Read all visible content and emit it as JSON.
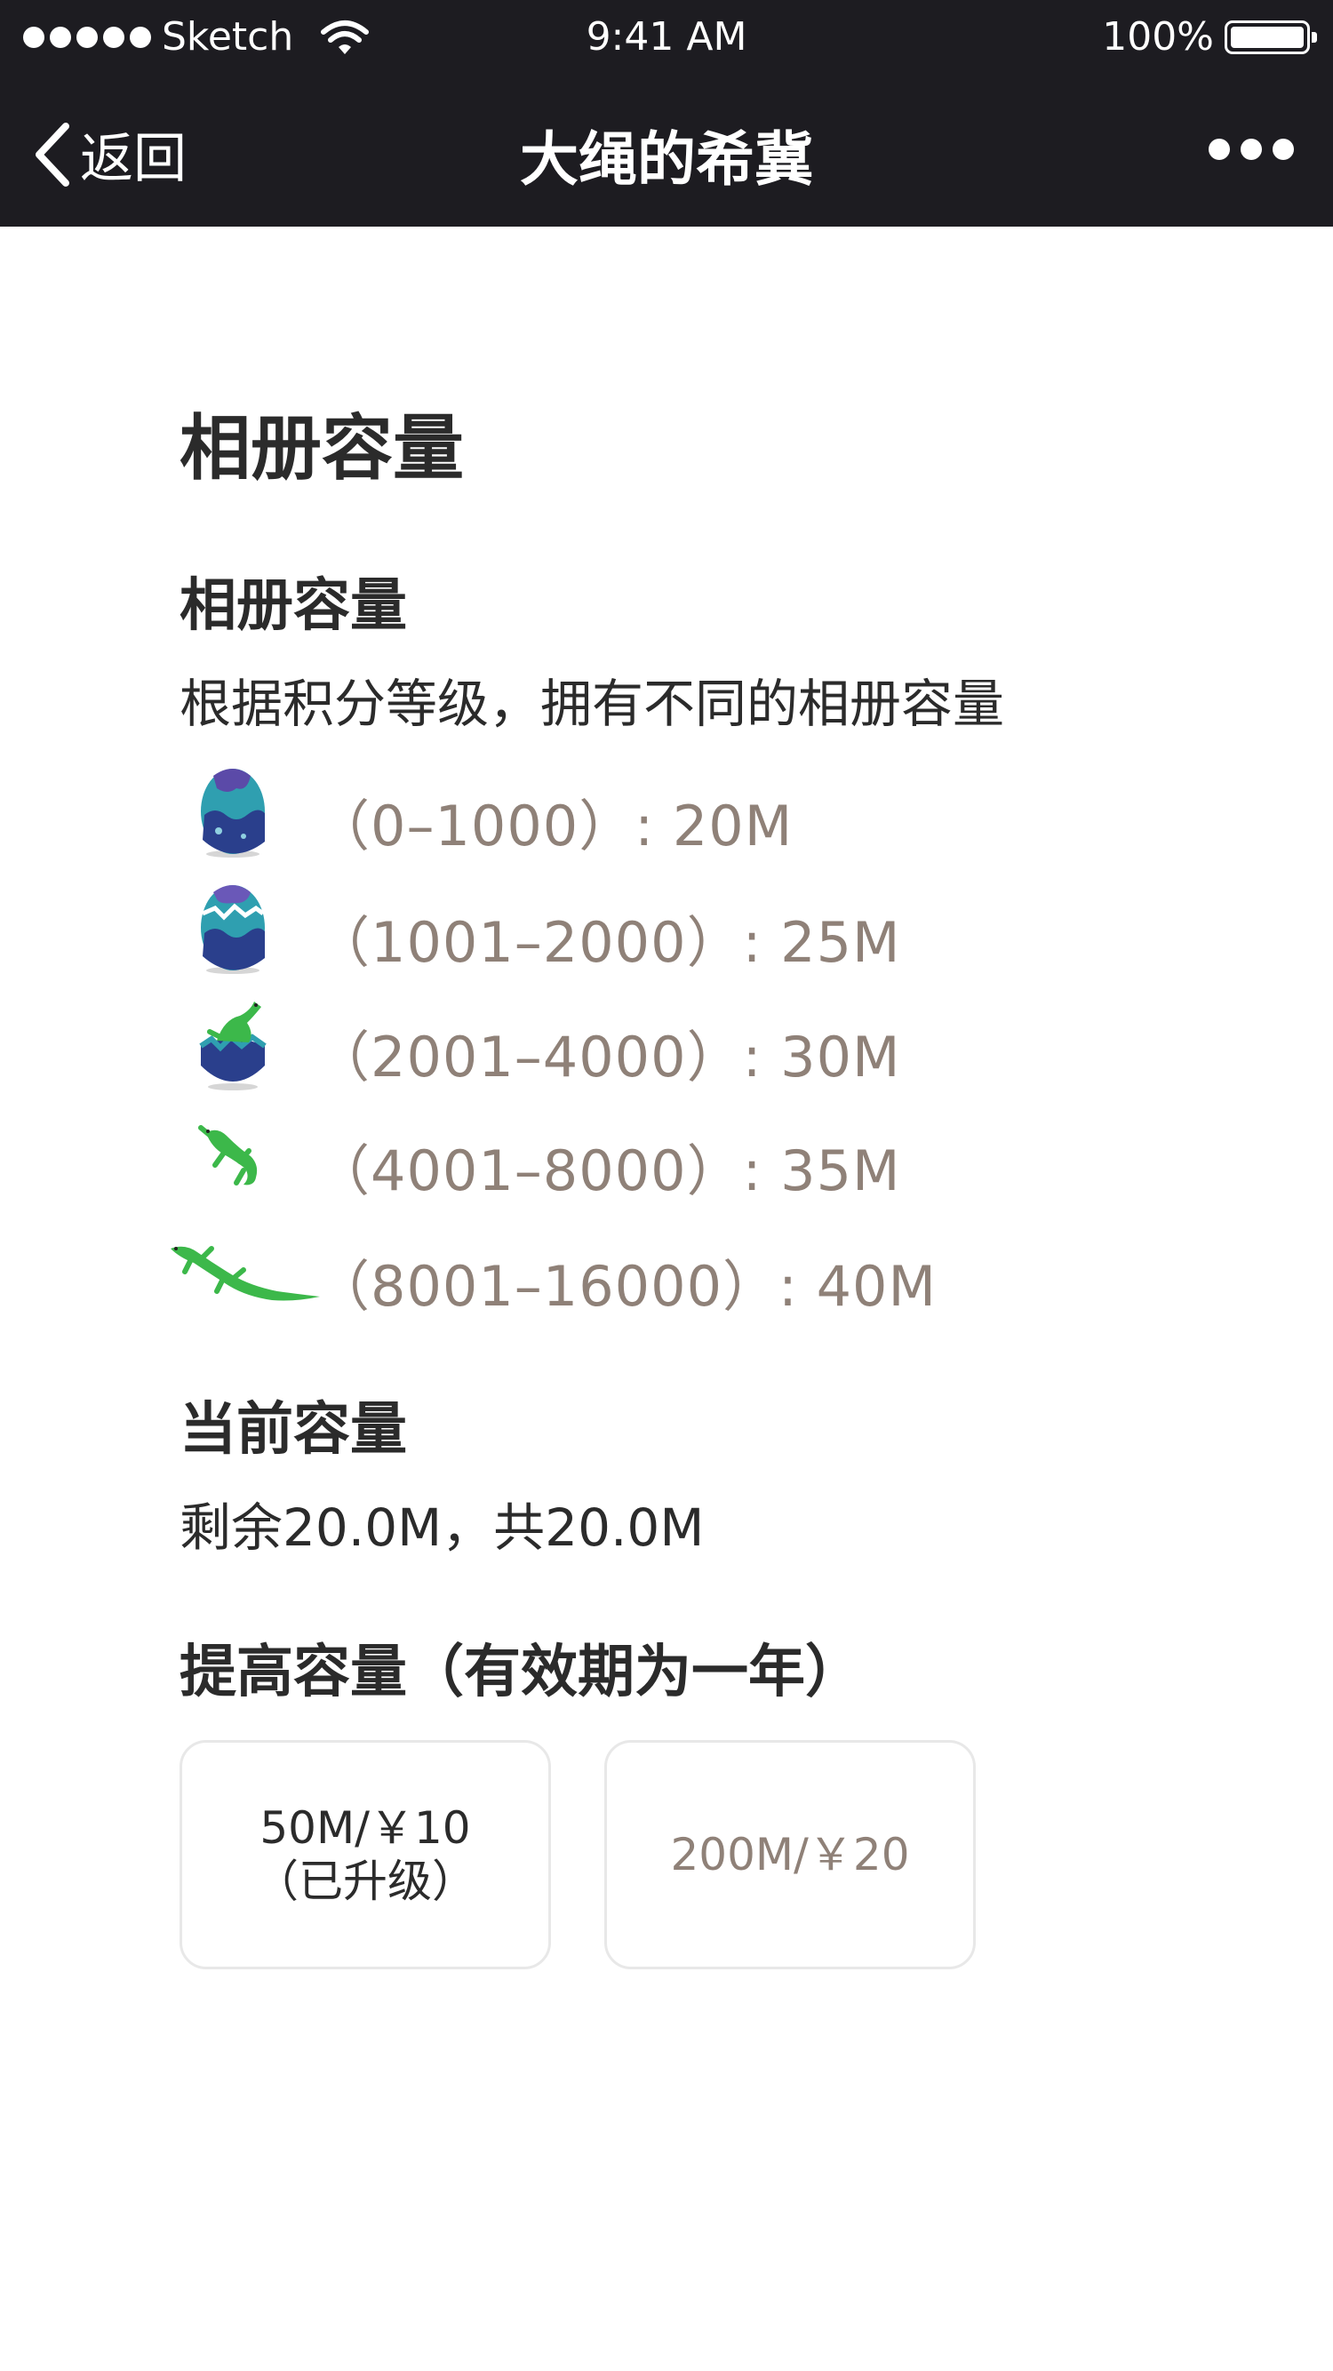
{
  "status_bar": {
    "carrier": "Sketch",
    "time": "9:41 AM",
    "battery": "100%",
    "battery_level": 1.0
  },
  "nav": {
    "back_label": "返回",
    "title": "大绳的希冀"
  },
  "page": {
    "title": "相册容量",
    "capacity_section": {
      "heading": "相册容量",
      "description": "根据积分等级，拥有不同的相册容量",
      "tiers": [
        {
          "range": "（0–1000）: 20M",
          "icon": "egg-icon"
        },
        {
          "range": "（1001–2000）: 25M",
          "icon": "cracked-egg-icon"
        },
        {
          "range": "（2001–4000）: 30M",
          "icon": "hatching-lizard-icon"
        },
        {
          "range": "（4001–8000）: 35M",
          "icon": "baby-lizard-icon"
        },
        {
          "range": "（8001–16000）: 40M",
          "icon": "lizard-icon"
        }
      ]
    },
    "current_section": {
      "heading": "当前容量",
      "value": "剩余20.0M，共20.0M"
    },
    "upgrade_section": {
      "heading": "提高容量（有效期为一年）",
      "options": [
        {
          "label": "50M/￥10",
          "sub": "（已升级）"
        },
        {
          "label": "200M/￥20"
        }
      ]
    }
  }
}
